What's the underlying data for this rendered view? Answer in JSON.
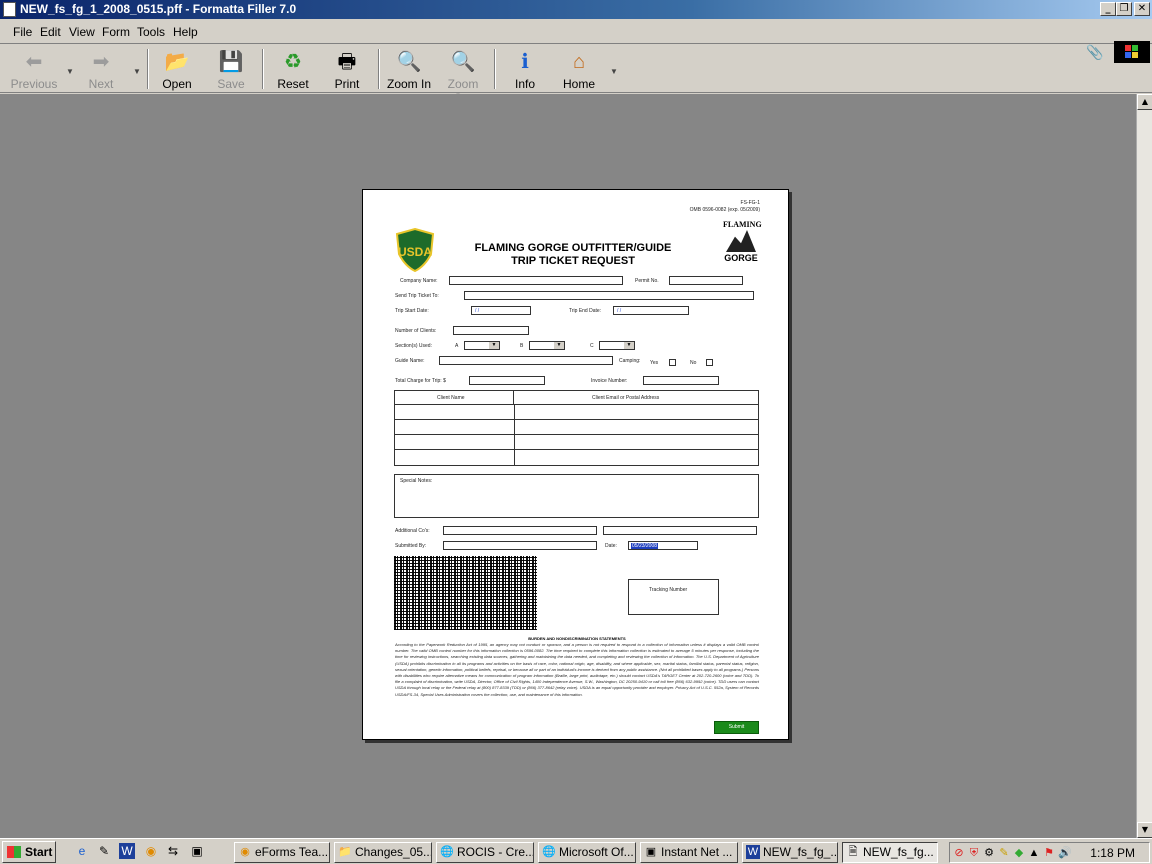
{
  "window": {
    "title": "NEW_fs_fg_1_2008_0515.pff - Formatta Filler 7.0"
  },
  "menu": [
    "File",
    "Edit",
    "View",
    "Form",
    "Tools",
    "Help"
  ],
  "toolbar": {
    "previous": "Previous",
    "next": "Next",
    "open": "Open",
    "save": "Save",
    "reset": "Reset",
    "print": "Print",
    "zoom_in": "Zoom In",
    "zoom_out": "Zoom Out",
    "info": "Info",
    "home": "Home"
  },
  "form": {
    "code": "FS-FG-1",
    "omb": "OMB 0596-0082 (exp. 05/2009)",
    "title_line1": "FLAMING GORGE OUTFITTER/GUIDE",
    "title_line2": "TRIP TICKET REQUEST",
    "logo_text": "USDA",
    "fg_logo_top": "FLAMING",
    "fg_logo_bottom": "GORGE",
    "labels": {
      "company_name": "Company Name:",
      "permit_no": "Permit No.",
      "send_to": "Send Trip Ticket To:",
      "start_date": "Trip Start Date:",
      "end_date": "Trip End Date:",
      "num_clients": "Number of Clients:",
      "sections_used": "Section(s) Used:",
      "sec_a": "A",
      "sec_b": "B",
      "sec_c": "C",
      "guide_name": "Guide Name:",
      "camping": "Camping:",
      "yes": "Yes",
      "no": "No",
      "total_charge": "Total Charge for Trip: $",
      "invoice_number": "Invoice Number:",
      "special_notes": "Special Notes:",
      "additional_cos": "Additional Co's:",
      "submitted_by": "Submitted By:",
      "date": "Date:",
      "tracking_number": "Tracking Number"
    },
    "date_placeholder": "/ /",
    "date_value": "05/23/2008",
    "table_headers": [
      "Client Name",
      "Client Email or Postal Address"
    ],
    "statement_title": "BURDEN AND NONDISCRIMINATION STATEMENTS",
    "statement_text": "According to the Paperwork Reduction Act of 1995, an agency may not conduct or sponsor, and a person is not required to respond to a collection of information unless it displays a valid OMB control number. The valid OMB control number for this information collection is 0596-0082. The time required to complete this information collection is estimated to average 5 minutes per response, including the time for reviewing instructions, searching existing data sources, gathering and maintaining the data needed, and completing and reviewing the collection of information. The U.S. Department of Agriculture (USDA) prohibits discrimination in all its programs and activities on the basis of race, color, national origin, age, disability, and where applicable, sex, marital status, familial status, parental status, religion, sexual orientation, genetic information, political beliefs, reprisal, or because all or part of an individual's income is derived from any public assistance. (Not all prohibited bases apply to all programs.) Persons with disabilities who require alternative means for communication of program information (Braille, large print, audiotape, etc.) should contact USDA's TARGET Center at 202-720-2600 (voice and TDD). To file a complaint of discrimination, write USDA, Director, Office of Civil Rights, 1400 Independence Avenue, S.W., Washington, DC 20250-9410 or call toll free (866) 632-9992 (voice). TDD users can contact USDA through local relay or the Federal relay at (800) 877-8339 (TDD) or (866) 377-8642 (relay voice). USDA is an equal opportunity provider and employer. Privacy Act of U.S.C. 552a, System of Records USDA/FS-34, Special Uses Administration covers the collection, use, and maintenance of this information.",
    "submit": "Submit"
  },
  "taskbar": {
    "start": "Start",
    "tasks": [
      "eForms Tea...",
      "Changes_05...",
      "ROCIS - Cre...",
      "Microsoft Of...",
      "Instant Net ...",
      "NEW_fs_fg_...",
      "NEW_fs_fg..."
    ],
    "clock": "1:18 PM"
  },
  "colors": {
    "title_gradient_start": "#0a246a",
    "title_gradient_end": "#a6caf0",
    "desktop_gray": "#868686",
    "submit_green": "#1a8a1a",
    "usda_green": "#1d6b2a",
    "usda_gold": "#e8c52a"
  }
}
